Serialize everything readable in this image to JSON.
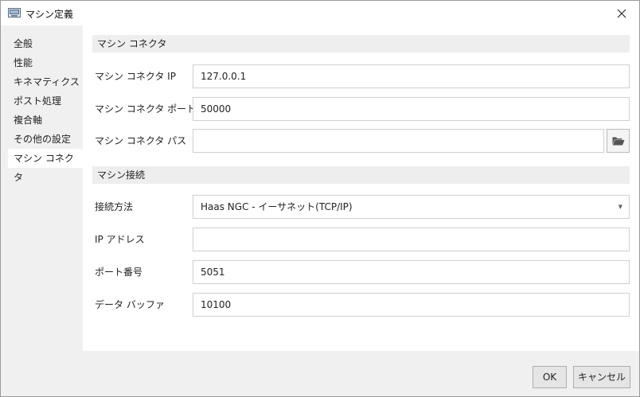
{
  "window": {
    "title": "マシン定義"
  },
  "sidebar": {
    "items": [
      {
        "label": "全般"
      },
      {
        "label": "性能"
      },
      {
        "label": "キネマティクス"
      },
      {
        "label": "ポスト処理"
      },
      {
        "label": "複合軸"
      },
      {
        "label": "その他の設定"
      },
      {
        "label": "マシン コネクタ",
        "active": true
      }
    ]
  },
  "connector": {
    "section_title": "マシン コネクタ",
    "ip_label": "マシン コネクタ IP",
    "ip_value": "127.0.0.1",
    "port_label": "マシン コネクタ ポート",
    "port_value": "50000",
    "path_label": "マシン コネクタ パス",
    "path_value": ""
  },
  "connection": {
    "section_title": "マシン接続",
    "method_label": "接続方法",
    "method_value": "Haas NGC - イーサネット(TCP/IP)",
    "ip_label": "IP アドレス",
    "ip_value": "",
    "port_label": "ポート番号",
    "port_value": "5051",
    "buffer_label": "データ バッファ",
    "buffer_value": "10100"
  },
  "footer": {
    "ok": "OK",
    "cancel": "キャンセル"
  },
  "icons": {
    "app": "machine-window-icon",
    "close": "close-icon",
    "browse": "folder-open-icon",
    "dropdown": "chevron-down-icon"
  }
}
